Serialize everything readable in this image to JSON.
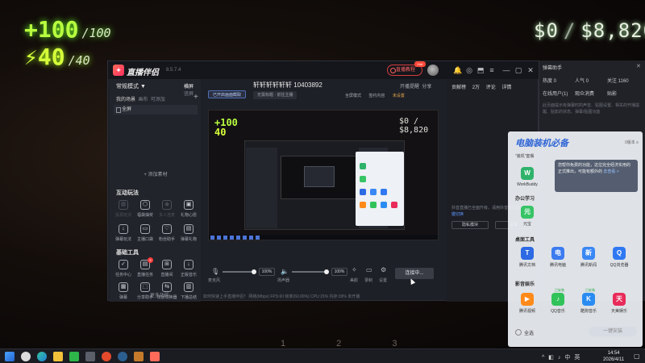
{
  "game": {
    "health": "+100",
    "health_max": "/100",
    "armor": "40",
    "armor_max": "/40",
    "money": "$0",
    "money_total": "$8,820",
    "ticks": "1 2 3"
  },
  "app": {
    "name": "直播伴侣",
    "version": "8.5.7.4",
    "live_button": "直播教程",
    "hot_badge": "Hot",
    "icons": [
      "notification-icon",
      "message-icon",
      "headset-icon",
      "shirt-icon",
      "menu-icon",
      "minimize-icon",
      "maximize-icon",
      "close-icon"
    ]
  },
  "left": {
    "mode": "常规模式 ▼",
    "mode_tabs": [
      "横屏",
      "竖屏"
    ],
    "scene_tabs": [
      "我的场景",
      "画布",
      "可添加"
    ],
    "scene_item": "全屏",
    "add_material": "+ 添加素材",
    "section_interact": "互动玩法",
    "interact_tools": [
      {
        "label": "投票玩法",
        "icon": "vote-icon",
        "dim": true
      },
      {
        "label": "福袋抽奖",
        "icon": "lucky-bag-icon",
        "dim": false
      },
      {
        "label": "多人连麦",
        "icon": "multi-mic-icon",
        "dim": true
      },
      {
        "label": "礼物心愿",
        "icon": "gift-icon",
        "dim": false
      },
      {
        "label": "弹幕玩法",
        "icon": "danmaku-icon",
        "dim": false
      },
      {
        "label": "主播口袋",
        "icon": "pocket-icon",
        "dim": false
      },
      {
        "label": "粉丝助手",
        "icon": "fans-icon",
        "dim": false
      },
      {
        "label": "弹幕礼物",
        "icon": "danmaku-gift-icon",
        "dim": false
      }
    ],
    "section_tools": "基础工具",
    "base_tools": [
      {
        "label": "任务中心",
        "icon": "task-icon",
        "badge": ""
      },
      {
        "label": "直播任务",
        "icon": "live-task-icon",
        "badge": "5"
      },
      {
        "label": "直播间",
        "icon": "room-icon",
        "badge": ""
      },
      {
        "label": "正版音乐",
        "icon": "music-icon",
        "badge": ""
      },
      {
        "label": "弹幕",
        "icon": "danmaku-list-icon",
        "badge": ""
      },
      {
        "label": "分享助手",
        "icon": "share-icon",
        "badge": ""
      },
      {
        "label": "场景切换器",
        "icon": "scene-switch-icon",
        "badge": ""
      },
      {
        "label": "下播总结",
        "icon": "summary-icon",
        "badge": ""
      }
    ],
    "more": "··· 更多功能"
  },
  "center": {
    "room_title": "轩轩轩轩轩轩 10403892",
    "room_icons": [
      "开播提醒",
      "分享"
    ],
    "layer_chip": "已开启画面截取",
    "title_pill": "无需标题 · 前往主播",
    "ctrl_links": [
      "全屏模式",
      "签约内容",
      "未设置"
    ],
    "preview": {
      "health": "+100",
      "armor": "40",
      "money": "$0 / $8,820"
    },
    "audio": {
      "mic_label": "麦克风",
      "mic_pct": "100%",
      "spk_label": "扬声器",
      "spk_pct": "100%",
      "tools": [
        "美颜",
        "录制",
        "设置"
      ]
    },
    "connect_button": "连接中...",
    "status": "如何快速上手直播伴侣？     网络(Mbps)  FPS:60  帧率(60.00%)  CPU:15%  内存:39%  未开播"
  },
  "right_col": {
    "contrib_tabs": [
      "贡献榜",
      "2万"
    ],
    "right_tabs": [
      "评论",
      "详情"
    ],
    "hint_prefix": "抖音直播已全面升级，请用抖音扫码登录，",
    "hint_link": "一键切换",
    "btn_left": "隐私模块",
    "btn_right": "设置"
  },
  "assist": {
    "title": "弹幕助手",
    "stats": [
      "热度 0",
      "人气 0",
      "关注 1160"
    ],
    "tabs": [
      "在线用户(1)",
      "观众消费",
      "贴影"
    ],
    "desc": "此页面提示有弹幕时的声音、贴图设置、相关的开播提醒、贴影的状态、弹幕/贴图功能"
  },
  "overlay": {
    "title": "电脑装机必备",
    "version": "0版本 ≡",
    "sub": "\"装机\"套餐",
    "tip_line1": "您帮你免费的功能，这位完全经济实用的",
    "tip_line2": "正式推出，可能有额外的",
    "tip_link": "去查看 >",
    "categories": [
      "办公学习",
      "桌面工具",
      "影音娱乐"
    ],
    "apps": [
      {
        "label": "WorkBuddy",
        "color": "#2fb36b",
        "glyph": "W"
      },
      {
        "label": "元宝",
        "color": "#36c466",
        "glyph": "元"
      },
      {
        "label": "腾讯文档",
        "color": "#2d6ae3",
        "glyph": "T"
      },
      {
        "label": "腾讯电脑",
        "color": "#3c7bf0",
        "glyph": "电"
      },
      {
        "label": "腾讯新闻",
        "color": "#3a88f5",
        "glyph": "新"
      },
      {
        "label": "QQ浏览器",
        "color": "#2f78f2",
        "glyph": "Q"
      },
      {
        "label": "腾讯视频",
        "color": "#ff8a1a",
        "glyph": "▶"
      },
      {
        "label": "QQ音乐",
        "color": "#31c35a",
        "glyph": "♪"
      },
      {
        "label": "酷狗音乐",
        "color": "#2a8cf2",
        "glyph": "K"
      },
      {
        "label": "天美娱乐",
        "color": "#e82b5a",
        "glyph": "天"
      }
    ],
    "app_tags": [
      "已安装",
      "已安装"
    ],
    "select_all": "全选",
    "install": "一键安装"
  },
  "taskbar": {
    "tray": [
      "^",
      "◧",
      "♪",
      "中",
      "英"
    ],
    "time": "14:54",
    "date": "2026/4/11",
    "apps": [
      "windows-start",
      "search",
      "edge",
      "explorer",
      "wechat",
      "gaming",
      "greenapp",
      "steam",
      "game2",
      "game3"
    ]
  }
}
